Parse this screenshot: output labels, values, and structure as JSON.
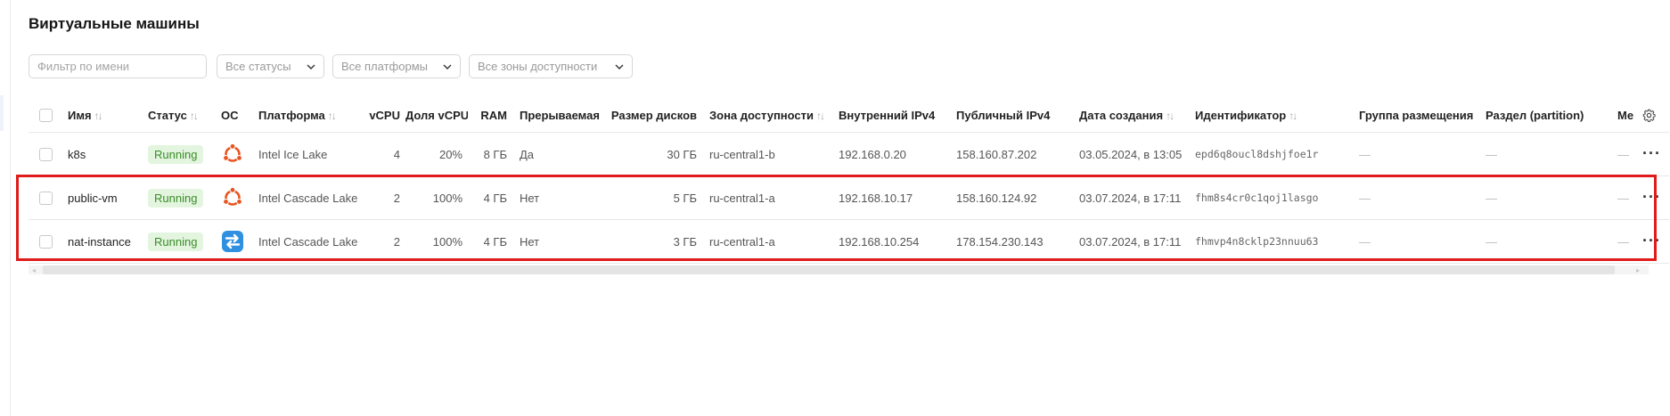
{
  "page": {
    "title": "Виртуальные машины"
  },
  "filters": {
    "name_placeholder": "Фильтр по имени",
    "status": "Все статусы",
    "platform": "Все платформы",
    "zone": "Все зоны доступности"
  },
  "table": {
    "columns": {
      "name": "Имя",
      "status": "Статус",
      "os": "ОС",
      "platform": "Платформа",
      "vcpu": "vCPU",
      "vcpu_share": "Доля vCPU",
      "ram": "RAM",
      "preemptible": "Прерываемая",
      "disk": "Размер дисков",
      "zone": "Зона доступности",
      "internal_ip": "Внутренний IPv4",
      "public_ip": "Публичный IPv4",
      "created": "Дата создания",
      "id": "Идентификатор",
      "placement": "Группа размещения",
      "partition": "Раздел (partition)",
      "extra": "Ме"
    },
    "rows": [
      {
        "name": "k8s",
        "status": "Running",
        "os_icon": "ubuntu-icon",
        "platform": "Intel Ice Lake",
        "vcpu": "4",
        "vcpu_share": "20%",
        "ram": "8 ГБ",
        "preemptible": "Да",
        "disk": "30 ГБ",
        "zone": "ru-central1-b",
        "internal_ip": "192.168.0.20",
        "public_ip": "158.160.87.202",
        "created": "03.05.2024, в 13:05",
        "id": "epd6q8oucl8dshjfoe1r",
        "placement": "—",
        "partition": "—",
        "extra": "—"
      },
      {
        "name": "public-vm",
        "status": "Running",
        "os_icon": "ubuntu-icon",
        "platform": "Intel Cascade Lake",
        "vcpu": "2",
        "vcpu_share": "100%",
        "ram": "4 ГБ",
        "preemptible": "Нет",
        "disk": "5 ГБ",
        "zone": "ru-central1-a",
        "internal_ip": "192.168.10.17",
        "public_ip": "158.160.124.92",
        "created": "03.07.2024, в 17:11",
        "id": "fhm8s4cr0c1qoj1lasgo",
        "placement": "—",
        "partition": "—",
        "extra": "—"
      },
      {
        "name": "nat-instance",
        "status": "Running",
        "os_icon": "nat-instance-icon",
        "platform": "Intel Cascade Lake",
        "vcpu": "2",
        "vcpu_share": "100%",
        "ram": "4 ГБ",
        "preemptible": "Нет",
        "disk": "3 ГБ",
        "zone": "ru-central1-a",
        "internal_ip": "192.168.10.254",
        "public_ip": "178.154.230.143",
        "created": "03.07.2024, в 17:11",
        "id": "fhmvp4n8cklp23nnuu63",
        "placement": "—",
        "partition": "—",
        "extra": "—"
      }
    ]
  },
  "icons": {
    "sort": "sort-arrows-icon",
    "chevron": "chevron-down-icon",
    "settings": "gear-icon",
    "row_actions": "more-actions-icon"
  },
  "colors": {
    "status_bg": "#e3f5df",
    "status_text": "#3a8d2a",
    "ubuntu": "#e95420",
    "nat_icon": "#2f8fe0",
    "highlight": "#e01b1b"
  }
}
